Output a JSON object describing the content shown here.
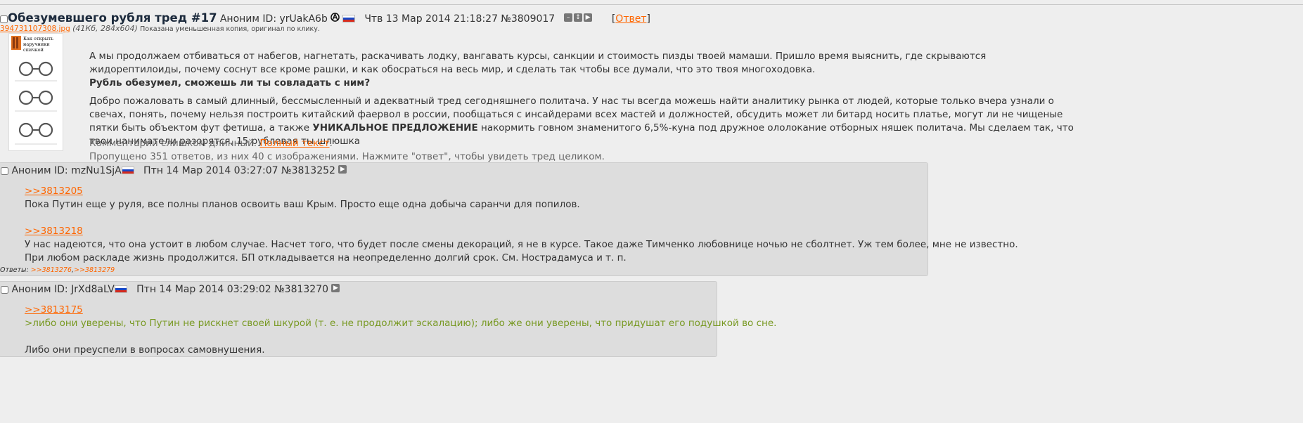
{
  "colors": {
    "accent": "#ff6600",
    "greentext": "#789922",
    "subject": "#1c2a3c",
    "reply_bg": "#dddddd"
  },
  "op": {
    "subject": "Обезумевшего рубля тред #17",
    "author": "Аноним ID: yrUakA6b",
    "date": "Чтв 13 Мар 2014 21:18:27",
    "number": "№3809017",
    "reply_link": "Ответ",
    "file": {
      "name": "394731107308.jpg",
      "dims": "(41Кб, 284x604)",
      "note": "Показана уменьшенная копия, оригинал по клику."
    },
    "thumb_title": "Как открыть наручники спичкой",
    "p1": "А мы продолжаем отбиваться от набегов, нагнетать, раскачивать лодку, вангавать курсы, санкции и стоимость пизды твоей мамаши. Пришло время выяснить, где скрываются жидорептилоиды, почему соснут все кроме рашки, и как обосраться на весь мир, и сделать так чтобы все думали, что это твоя многоходовка.",
    "p1_bold": "Рубль обезумел, сможешь ли ты совладать с ним?",
    "p2_start": "Добро пожаловать в самый длинный, бессмысленный и адекватный тред сегодняшнего политача. У нас ты всегда можешь найти аналитику рынка от людей, которые только вчера узнали о свечах, понять, почему нельзя построить китайский фаервол в россии, пообщаться с инсайдерами всех мастей и должностей, обсудить может ли битард носить платье, могут ли не чищеные пятки быть объектом фут фетиша, а также ",
    "p2_bold": "УНИКАЛЬНОЕ ПРЕДЛОЖЕНИЕ",
    "p2_end": " накормить говном знаменитого 6,5%-куна под дружное ололокание отборных няшек политача. Мы сделаем так, что твои наниматели разорятся, 15 рублевая ты шлюшка",
    "too_long": "Комментарий слишком длинный. ",
    "full_text": "Полный текст",
    "skipped": "Пропущено 351 ответов, из них 40 с изображениями. Нажмите \"ответ\", чтобы увидеть тред целиком."
  },
  "replies": [
    {
      "author": "Аноним ID: mzNu1SjA",
      "date": "Птн 14 Мар 2014 03:27:07",
      "number": "№3813252",
      "ref1": ">>3813205",
      "line1": "Пока Путин еще у руля, все полны планов освоить ваш Крым. Просто еще одна добыча саранчи для попилов.",
      "ref2": ">>3813218",
      "line2": "У нас надеются, что она устоит в любом случае. Насчет того, что будет после смены декораций, я не в курсе. Такое даже Тимченко любовнице ночью не сболтнет. Уж тем более, мне не известно.",
      "line3": "При любом раскладе жизнь продолжится. БП откладывается на неопределенно долгий срок. См. Нострадамуса и т. п.",
      "answers_label": "Ответы: ",
      "answers": [
        ">>3813276",
        ">>3813279"
      ]
    },
    {
      "author": "Аноним ID: JrXd8aLV",
      "date": "Птн 14 Мар 2014 03:29:02",
      "number": "№3813270",
      "ref1": ">>3813175",
      "green": ">либо они уверены, что Путин не рискнет своей шкурой (т. е. не продолжит эскалацию); либо же они уверены, что придушат его подушкой во сне.",
      "line1": "Либо они преуспели в вопросах самовнушения."
    }
  ]
}
